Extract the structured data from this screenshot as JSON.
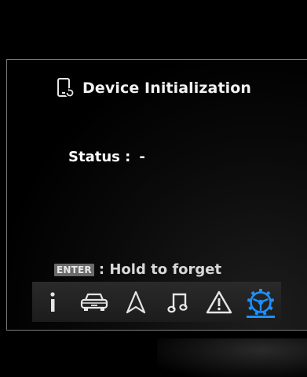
{
  "title": {
    "icon": "phone-reset-icon",
    "text": "Device Initialization"
  },
  "status": {
    "label": "Status :",
    "value": "-"
  },
  "hint": {
    "key": "ENTER",
    "text": ": Hold to forget"
  },
  "tabs": [
    {
      "icon": "info-icon",
      "active": false
    },
    {
      "icon": "car-icon",
      "active": false
    },
    {
      "icon": "navigation-arrow-icon",
      "active": false
    },
    {
      "icon": "music-note-icon",
      "active": false
    },
    {
      "icon": "warning-triangle-icon",
      "active": false
    },
    {
      "icon": "settings-steering-icon",
      "active": true
    }
  ],
  "colors": {
    "accent": "#1e8fff",
    "text": "#ffffff",
    "icon": "#e6e6e6"
  }
}
